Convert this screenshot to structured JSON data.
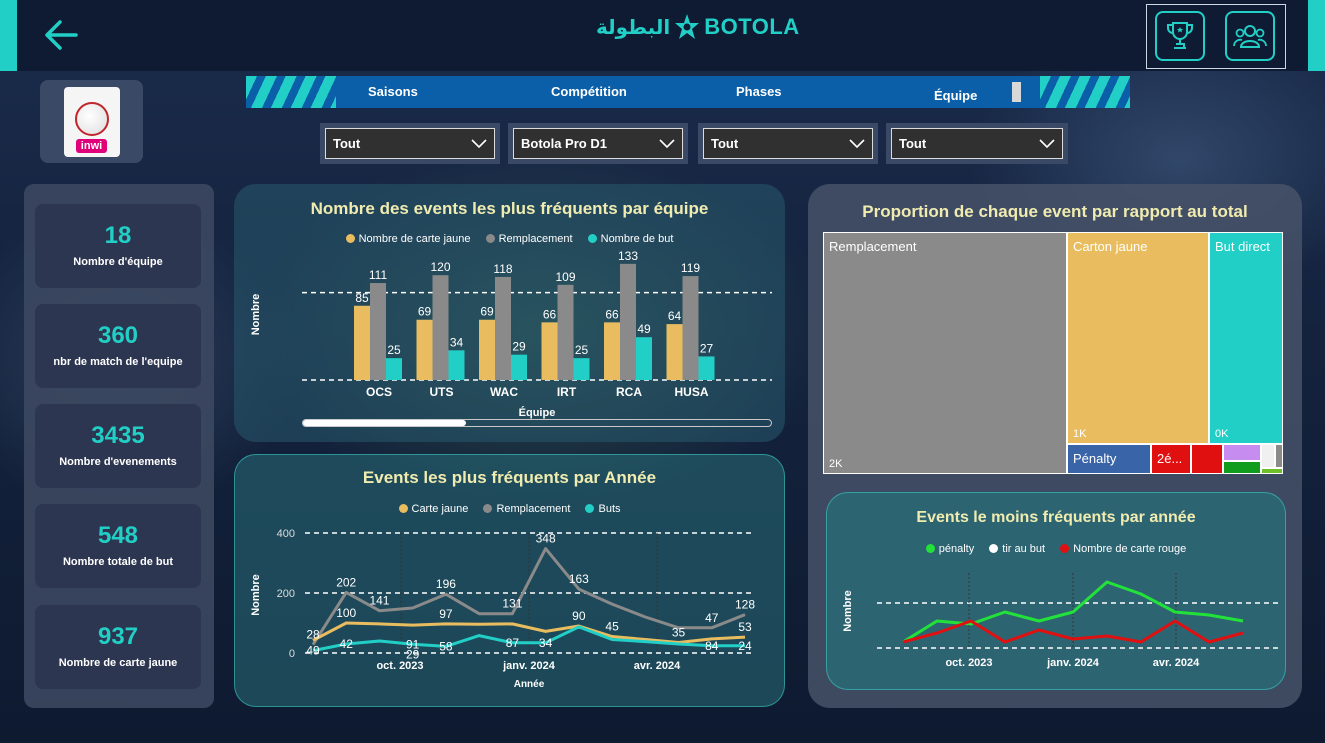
{
  "header": {
    "logo_arabic": "البطولة",
    "logo_text": "BOTOLA"
  },
  "brand": {
    "badge_text": "inwi"
  },
  "nav": {
    "tabs": [
      {
        "label": "Saisons"
      },
      {
        "label": "Compétition"
      },
      {
        "label": "Phases"
      },
      {
        "label": "Équipe"
      }
    ]
  },
  "filters": [
    {
      "value": "Tout"
    },
    {
      "value": "Botola Pro D1"
    },
    {
      "value": "Tout"
    },
    {
      "value": "Tout"
    }
  ],
  "kpis": [
    {
      "value": "18",
      "label": "Nombre d'équipe"
    },
    {
      "value": "360",
      "label": "nbr de match de l'equipe"
    },
    {
      "value": "3435",
      "label": "Nombre d'evenements"
    },
    {
      "value": "548",
      "label": "Nombre totale de but"
    },
    {
      "value": "937",
      "label": "Nombre de carte jaune"
    }
  ],
  "colors": {
    "yellow": "#e9bd5f",
    "gray": "#8a8a8a",
    "teal": "#22cfc6",
    "green": "#22e23a",
    "red": "#e01010",
    "white": "#ffffff"
  },
  "chart_data": [
    {
      "type": "bar",
      "title": "Nombre des events les plus fréquents par équipe",
      "xlabel": "Équipe",
      "ylabel": "Nombre",
      "categories": [
        "OCS",
        "UTS",
        "WAC",
        "IRT",
        "RCA",
        "HUSA"
      ],
      "series": [
        {
          "name": "Nombre de carte jaune",
          "values": [
            85,
            69,
            69,
            66,
            66,
            64
          ]
        },
        {
          "name": "Remplacement",
          "values": [
            111,
            120,
            118,
            109,
            133,
            119
          ]
        },
        {
          "name": "Nombre de but",
          "values": [
            25,
            34,
            29,
            25,
            49,
            27
          ]
        }
      ],
      "ylim": [
        0,
        150
      ],
      "legend": "top"
    },
    {
      "type": "line",
      "title": "Events les plus fréquents par Année",
      "xlabel": "Année",
      "ylabel": "Nombre",
      "y_ticks": [
        0,
        200,
        400
      ],
      "x_tick_labels": [
        "oct. 2023",
        "janv. 2024",
        "avr. 2024"
      ],
      "series": [
        {
          "name": "Carte jaune",
          "values": [
            42,
            100,
            97,
            93,
            97,
            96,
            97,
            72,
            90,
            55,
            45,
            35,
            47,
            53
          ]
        },
        {
          "name": "Remplacement",
          "values": [
            28,
            202,
            141,
            150,
            196,
            131,
            131,
            348,
            213,
            163,
            120,
            84,
            84,
            128
          ]
        },
        {
          "name": "Buts",
          "values": [
            8,
            30,
            40,
            29,
            22,
            58,
            34,
            34,
            87,
            45,
            38,
            30,
            24,
            24
          ]
        }
      ],
      "point_labels": [
        {
          "series": "Remplacement",
          "values": [
            "28",
            "202",
            "141",
            "",
            "196",
            "",
            "131",
            "348",
            "163",
            "",
            "",
            "",
            "47",
            "128"
          ]
        },
        {
          "series": "Carte jaune",
          "values": [
            "",
            "100",
            "",
            "",
            "97",
            "",
            "",
            "",
            "90",
            "45",
            "",
            "35",
            "",
            "53"
          ]
        },
        {
          "series": "Buts",
          "values": [
            "49",
            "42",
            "",
            "91",
            "58",
            "",
            "87",
            "34",
            "",
            "",
            "",
            "",
            "84",
            "24"
          ]
        },
        {
          "series": "Buts-extra",
          "values": [
            "",
            "",
            "",
            "29",
            "",
            "",
            "",
            "",
            "",
            "",
            "",
            "",
            "",
            ""
          ]
        }
      ],
      "ylim": [
        0,
        420
      ],
      "legend": "top"
    },
    {
      "type": "treemap",
      "title": "Proportion de chaque event par rapport au total",
      "items": [
        {
          "label": "Remplacement",
          "value_label": "2K",
          "color": "#8a8a8a"
        },
        {
          "label": "Carton jaune",
          "value_label": "1K",
          "color": "#e9bd5f"
        },
        {
          "label": "But direct",
          "value_label": "0K",
          "color": "#22cfc6"
        },
        {
          "label": "Pénalty",
          "value_label": "",
          "color": "#3a64a8"
        },
        {
          "label": "2é...",
          "value_label": "",
          "color": "#e01010"
        }
      ]
    },
    {
      "type": "line",
      "title": "Events le moins fréquents par année",
      "ylabel": "Nombre",
      "x_tick_labels": [
        "oct. 2023",
        "janv. 2024",
        "avr. 2024"
      ],
      "series": [
        {
          "name": "pénalty",
          "values": [
            2,
            9,
            8,
            12,
            9,
            12,
            22,
            18,
            12,
            11,
            9
          ]
        },
        {
          "name": "tir au but",
          "values": [
            0,
            0,
            0,
            0,
            0,
            0,
            0,
            0,
            0,
            0,
            0
          ]
        },
        {
          "name": "Nombre de carte rouge",
          "values": [
            2,
            5,
            9,
            2,
            6,
            3,
            4,
            2,
            9,
            2,
            5
          ]
        }
      ],
      "ylim": [
        0,
        25
      ],
      "legend": "top"
    }
  ]
}
